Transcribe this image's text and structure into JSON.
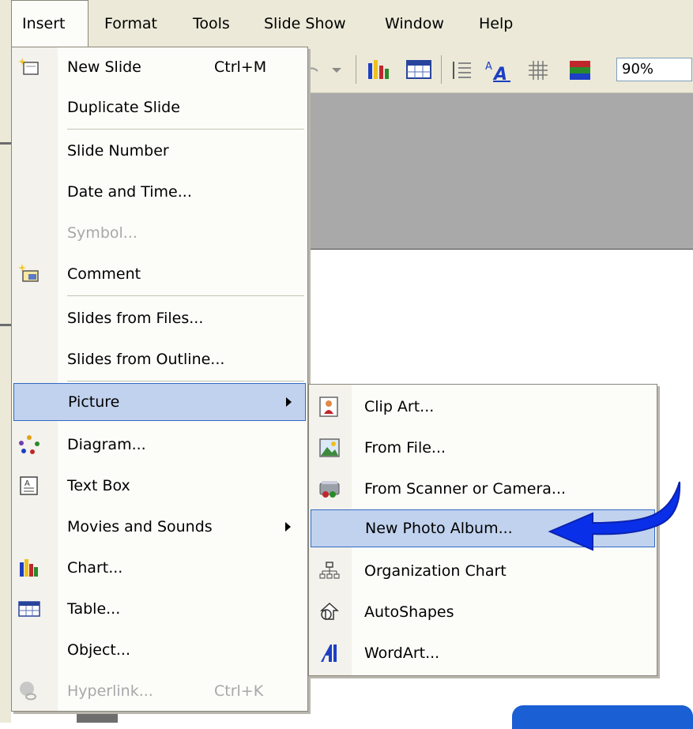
{
  "menubar": {
    "items": [
      {
        "label": "Insert"
      },
      {
        "label": "Format"
      },
      {
        "label": "Tools"
      },
      {
        "label": "Slide Show"
      },
      {
        "label": "Window"
      },
      {
        "label": "Help"
      }
    ]
  },
  "toolbar": {
    "zoom": "90%"
  },
  "insert_menu": {
    "items": [
      {
        "label": "New Slide",
        "shortcut": "Ctrl+M"
      },
      {
        "label": "Duplicate Slide"
      },
      {
        "label": "Slide Number"
      },
      {
        "label": "Date and Time..."
      },
      {
        "label": "Symbol..."
      },
      {
        "label": "Comment"
      },
      {
        "label": "Slides from Files..."
      },
      {
        "label": "Slides from Outline..."
      },
      {
        "label": "Picture"
      },
      {
        "label": "Diagram..."
      },
      {
        "label": "Text Box"
      },
      {
        "label": "Movies and Sounds"
      },
      {
        "label": "Chart..."
      },
      {
        "label": "Table..."
      },
      {
        "label": "Object..."
      },
      {
        "label": "Hyperlink...",
        "shortcut": "Ctrl+K"
      }
    ]
  },
  "picture_submenu": {
    "items": [
      {
        "label": "Clip Art..."
      },
      {
        "label": "From File..."
      },
      {
        "label": "From Scanner or Camera..."
      },
      {
        "label": "New Photo Album..."
      },
      {
        "label": "Organization Chart"
      },
      {
        "label": "AutoShapes"
      },
      {
        "label": "WordArt..."
      }
    ]
  },
  "colors": {
    "highlight": "#c1d2ee",
    "highlight_border": "#316ac5",
    "callout_arrow": "#0a2fe8"
  }
}
